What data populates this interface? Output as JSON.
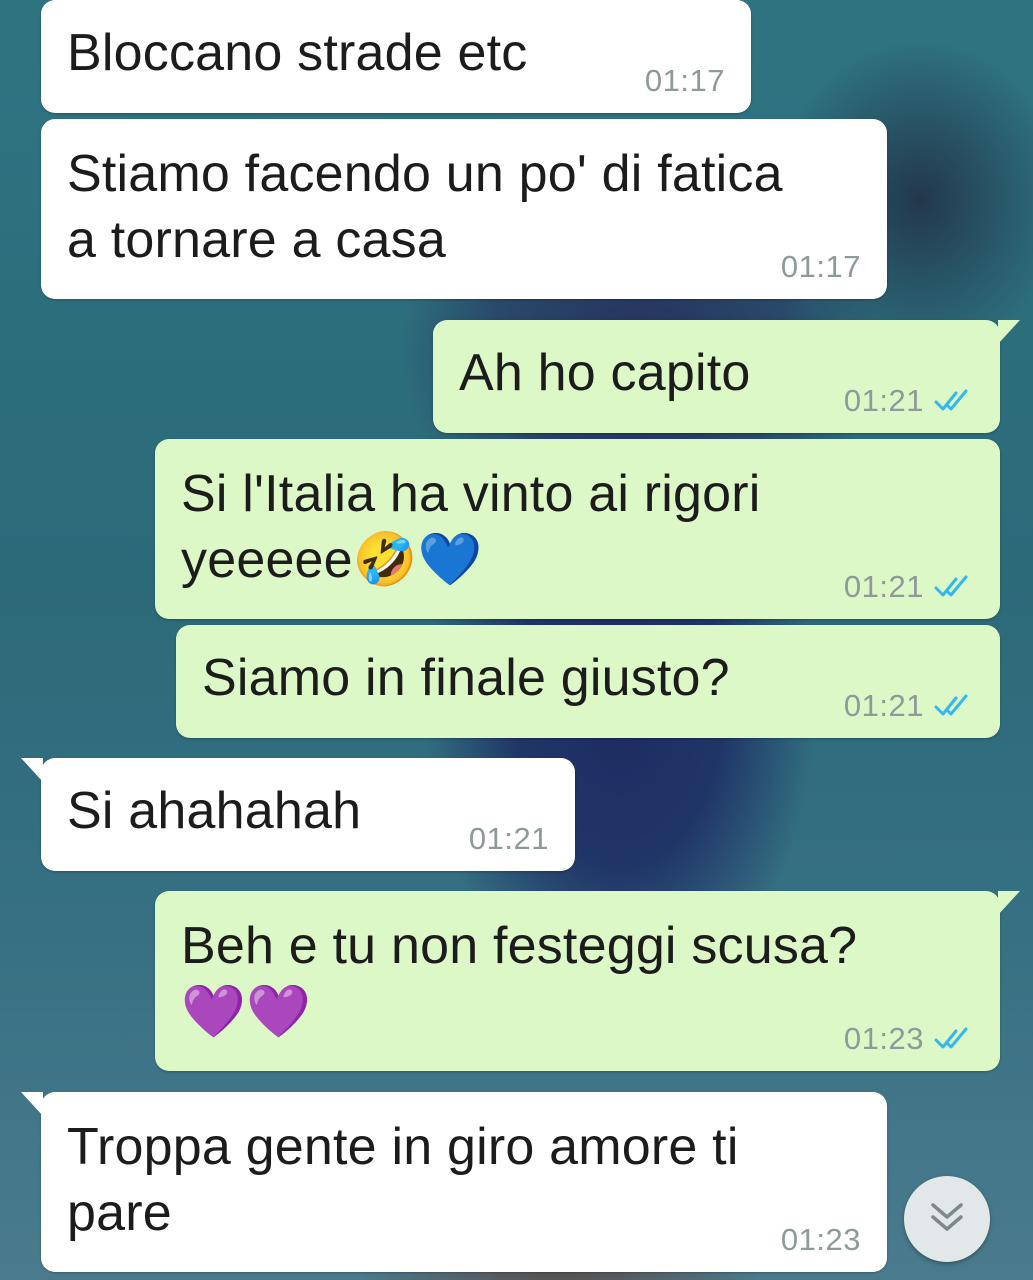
{
  "messages": [
    {
      "direction": "in",
      "text": "Bloccano strade etc",
      "time": "01:17"
    },
    {
      "direction": "in",
      "text": "Stiamo facendo un po' di fatica\na tornare a casa",
      "time": "01:17"
    },
    {
      "direction": "out",
      "text": "Ah ho capito",
      "time": "01:21",
      "status": "read"
    },
    {
      "direction": "out",
      "text": "Si l'Italia ha vinto ai rigori\nyeeeee🤣💙",
      "time": "01:21",
      "status": "read"
    },
    {
      "direction": "out",
      "text": "Siamo in finale giusto?",
      "time": "01:21",
      "status": "read"
    },
    {
      "direction": "in",
      "text": "Si ahahahah",
      "time": "01:21"
    },
    {
      "direction": "out",
      "text": "Beh e tu non festeggi scusa?\n💜💜",
      "time": "01:23",
      "status": "read"
    },
    {
      "direction": "in",
      "text": "Troppa gente in giro amore ti\npare",
      "time": "01:23"
    }
  ],
  "scroll_button": {
    "icon": "chevron-double-down-icon"
  },
  "colors": {
    "incoming_bubble": "#ffffff",
    "outgoing_bubble": "#dcf8c6",
    "timestamp": "#8e9a9a",
    "read_ticks": "#34b7f1"
  }
}
